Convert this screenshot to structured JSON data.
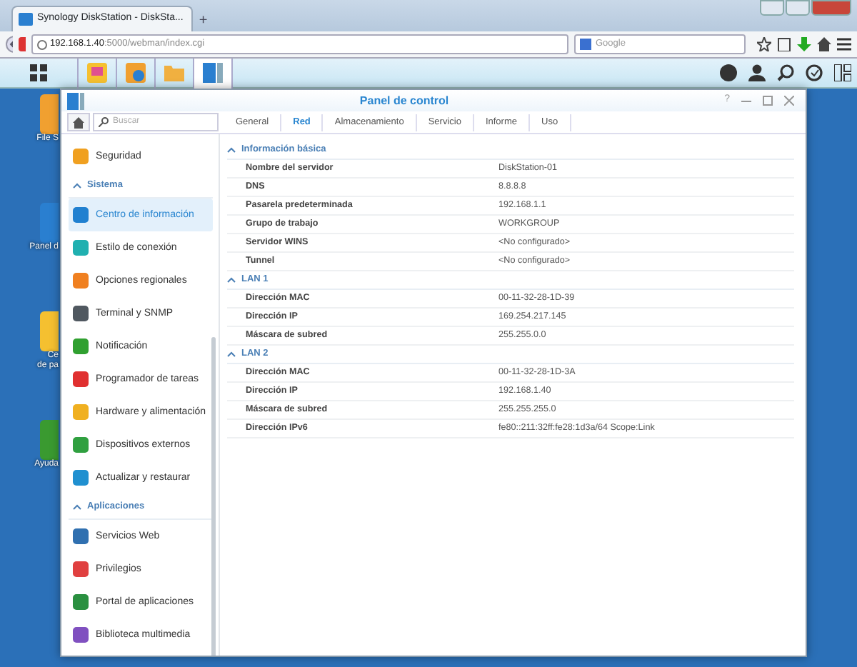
{
  "browser": {
    "tab_title": "Synology DiskStation - DiskSta...",
    "new_tab": "+",
    "url_host": "192.168.1.40",
    "url_path": ":5000/webman/index.cgi",
    "search_placeholder": "Google"
  },
  "desktop_icons": [
    {
      "lines": [
        "File S"
      ],
      "color": "#f0a030"
    },
    {
      "lines": [
        "Panel d"
      ],
      "color": "#2a7fd0"
    },
    {
      "lines": [
        "Ce",
        "de pa"
      ],
      "color": "#f5c030"
    },
    {
      "lines": [
        "Ayuda"
      ],
      "color": "#3a9a30"
    }
  ],
  "window": {
    "title": "Panel de control",
    "search_placeholder": "Buscar",
    "help": "?",
    "tabs": [
      {
        "label": "General",
        "selected": false
      },
      {
        "label": "Red",
        "selected": true
      },
      {
        "label": "Almacenamiento",
        "selected": false
      },
      {
        "label": "Servicio",
        "selected": false
      },
      {
        "label": "Informe",
        "selected": false
      },
      {
        "label": "Uso",
        "selected": false
      }
    ],
    "sidebar": [
      {
        "kind": "item",
        "label": "Seguridad",
        "selected": false,
        "color": "#f0a020"
      },
      {
        "kind": "section",
        "label": "Sistema"
      },
      {
        "kind": "item",
        "label": "Centro de información",
        "selected": true,
        "color": "#2080d0"
      },
      {
        "kind": "item",
        "label": "Estilo de conexión",
        "selected": false,
        "color": "#20b0b0"
      },
      {
        "kind": "item",
        "label": "Opciones regionales",
        "selected": false,
        "color": "#f08020"
      },
      {
        "kind": "item",
        "label": "Terminal y SNMP",
        "selected": false,
        "color": "#505860"
      },
      {
        "kind": "item",
        "label": "Notificación",
        "selected": false,
        "color": "#30a030"
      },
      {
        "kind": "item",
        "label": "Programador de tareas",
        "selected": false,
        "color": "#e03030"
      },
      {
        "kind": "item",
        "label": "Hardware y alimentación",
        "selected": false,
        "color": "#f0b020"
      },
      {
        "kind": "item",
        "label": "Dispositivos externos",
        "selected": false,
        "color": "#30a040"
      },
      {
        "kind": "item",
        "label": "Actualizar y restaurar",
        "selected": false,
        "color": "#2090d0"
      },
      {
        "kind": "section",
        "label": "Aplicaciones"
      },
      {
        "kind": "item",
        "label": "Servicios Web",
        "selected": false,
        "color": "#3070b0"
      },
      {
        "kind": "item",
        "label": "Privilegios",
        "selected": false,
        "color": "#e04040"
      },
      {
        "kind": "item",
        "label": "Portal de aplicaciones",
        "selected": false,
        "color": "#2a9040"
      },
      {
        "kind": "item",
        "label": "Biblioteca multimedia",
        "selected": false,
        "color": "#8050c0"
      }
    ],
    "sections": [
      {
        "title": "Información básica",
        "rows": [
          {
            "label": "Nombre del servidor",
            "value": "DiskStation-01"
          },
          {
            "label": "DNS",
            "value": "8.8.8.8"
          },
          {
            "label": "Pasarela predeterminada",
            "value": "192.168.1.1"
          },
          {
            "label": "Grupo de trabajo",
            "value": "WORKGROUP"
          },
          {
            "label": "Servidor WINS",
            "value": "<No configurado>"
          },
          {
            "label": "Tunnel",
            "value": "<No configurado>"
          }
        ]
      },
      {
        "title": "LAN 1",
        "rows": [
          {
            "label": "Dirección MAC",
            "value": "00-11-32-28-1D-39"
          },
          {
            "label": "Dirección IP",
            "value": "169.254.217.145"
          },
          {
            "label": "Máscara de subred",
            "value": "255.255.0.0"
          }
        ]
      },
      {
        "title": "LAN 2",
        "rows": [
          {
            "label": "Dirección MAC",
            "value": "00-11-32-28-1D-3A"
          },
          {
            "label": "Dirección IP",
            "value": "192.168.1.40"
          },
          {
            "label": "Máscara de subred",
            "value": "255.255.255.0"
          },
          {
            "label": "Dirección IPv6",
            "value": "fe80::211:32ff:fe28:1d3a/64 Scope:Link"
          }
        ]
      }
    ]
  }
}
